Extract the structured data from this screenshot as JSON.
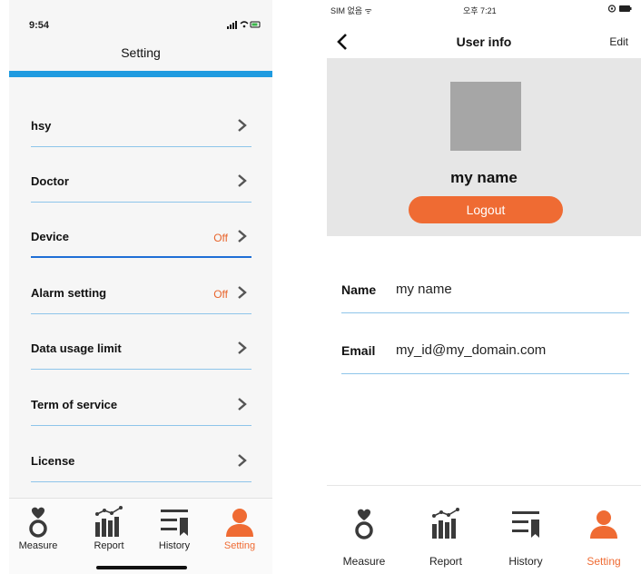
{
  "left": {
    "status": {
      "time": "9:54"
    },
    "title": "Setting",
    "items": [
      {
        "label": "hsy",
        "value": ""
      },
      {
        "label": "Doctor",
        "value": ""
      },
      {
        "label": "Device",
        "value": "Off"
      },
      {
        "label": "Alarm setting",
        "value": "Off"
      },
      {
        "label": "Data usage limit",
        "value": ""
      },
      {
        "label": "Term of service",
        "value": ""
      },
      {
        "label": "License",
        "value": ""
      }
    ]
  },
  "right": {
    "status": {
      "carrier": "SIM 없음 ᯤ",
      "time": "오후 7:21"
    },
    "nav": {
      "title": "User info",
      "edit": "Edit"
    },
    "profile": {
      "name": "my name",
      "logout": "Logout"
    },
    "fields": [
      {
        "label": "Name",
        "value": "my name"
      },
      {
        "label": "Email",
        "value": "my_id@my_domain.com"
      }
    ]
  },
  "tabs": {
    "measure": "Measure",
    "report": "Report",
    "history": "History",
    "setting": "Setting"
  },
  "colors": {
    "accent": "#ef6b33",
    "blue_bar": "#1f9be0",
    "divider": "#8ec5ea",
    "icon": "#3a3a3a"
  },
  "icons": [
    "heart-ring-icon",
    "bar-chart-icon",
    "list-bookmark-icon",
    "person-icon",
    "chevron-right-icon",
    "back-arrow-icon"
  ]
}
